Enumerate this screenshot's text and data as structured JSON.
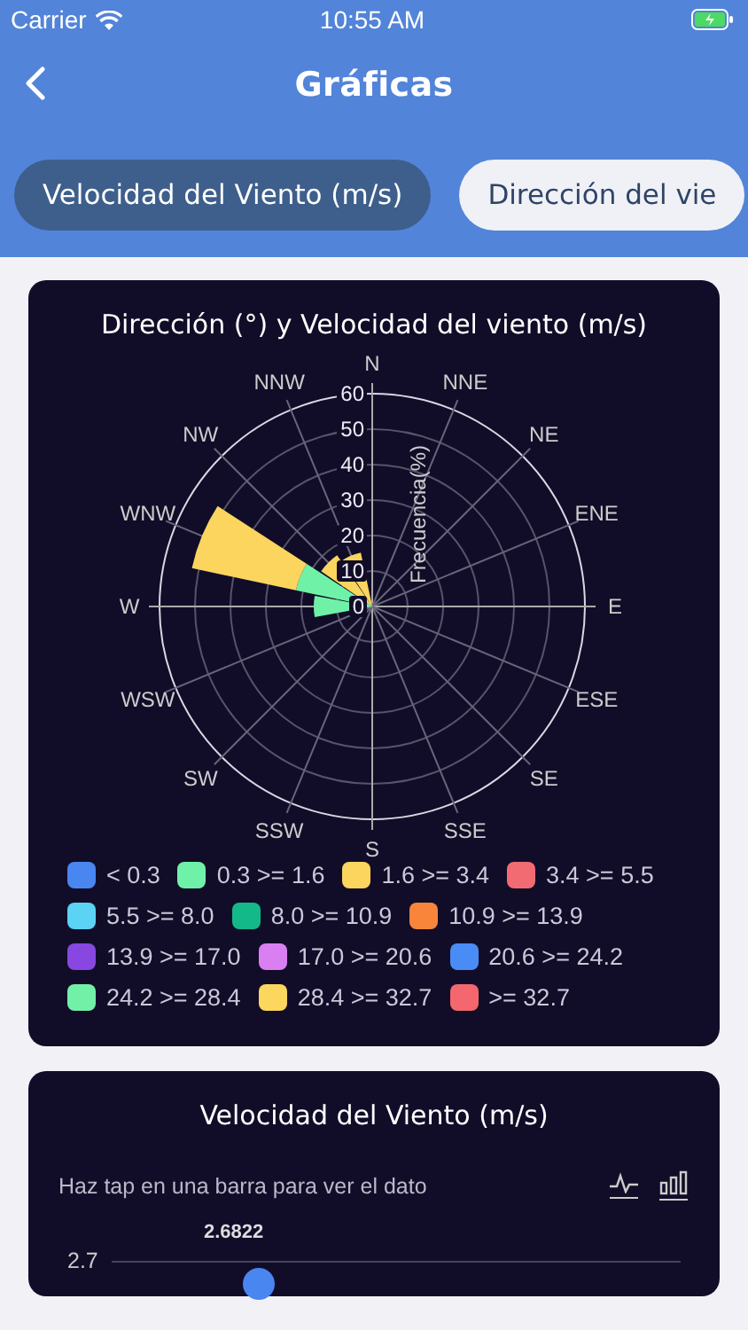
{
  "status_bar": {
    "carrier": "Carrier",
    "time": "10:55 AM"
  },
  "header": {
    "title": "Gráficas"
  },
  "tabs": [
    {
      "label": "Velocidad del Viento (m/s)",
      "selected": true
    },
    {
      "label": "Dirección del vie",
      "selected": false
    }
  ],
  "wind_rose": {
    "title": "Dirección (°) y Velocidad del viento (m/s)",
    "directions": [
      "N",
      "NNW",
      "NNE",
      "NW",
      "NE",
      "WNW",
      "ENE",
      "W",
      "E",
      "WSW",
      "ESE",
      "SW",
      "SE",
      "SSW",
      "SSE",
      "S"
    ],
    "radial_ticks": [
      "60",
      "50",
      "40",
      "30",
      "20",
      "10",
      "0"
    ],
    "axis_title": "Frecuencia(%)",
    "legend": [
      {
        "label": "< 0.3",
        "color": "#4a86f0"
      },
      {
        "label": "0.3 >= 1.6",
        "color": "#6ff2a8"
      },
      {
        "label": "1.6 >= 3.4",
        "color": "#fbd55e"
      },
      {
        "label": "3.4 >= 5.5",
        "color": "#f26b73"
      },
      {
        "label": "5.5 >= 8.0",
        "color": "#5ad3f5"
      },
      {
        "label": "8.0 >= 10.9",
        "color": "#14b98a"
      },
      {
        "label": "10.9 >= 13.9",
        "color": "#f9853b"
      },
      {
        "label": "13.9 >= 17.0",
        "color": "#8747e0"
      },
      {
        "label": "17.0 >= 20.6",
        "color": "#d97ff2"
      },
      {
        "label": "20.6 >= 24.2",
        "color": "#4a8cf5"
      },
      {
        "label": "24.2 >= 28.4",
        "color": "#72f0a8"
      },
      {
        "label": "28.4 >= 32.7",
        "color": "#fbd75d"
      },
      {
        "label": ">= 32.7",
        "color": "#f4676f"
      }
    ]
  },
  "speed_chart": {
    "title": "Velocidad del Viento (m/s)",
    "hint": "Haz tap en una barra para ver el dato",
    "view_options": [
      {
        "kind": "line"
      },
      {
        "kind": "bar"
      }
    ],
    "y_tick": "2.7",
    "point_label": "2.6822"
  }
}
